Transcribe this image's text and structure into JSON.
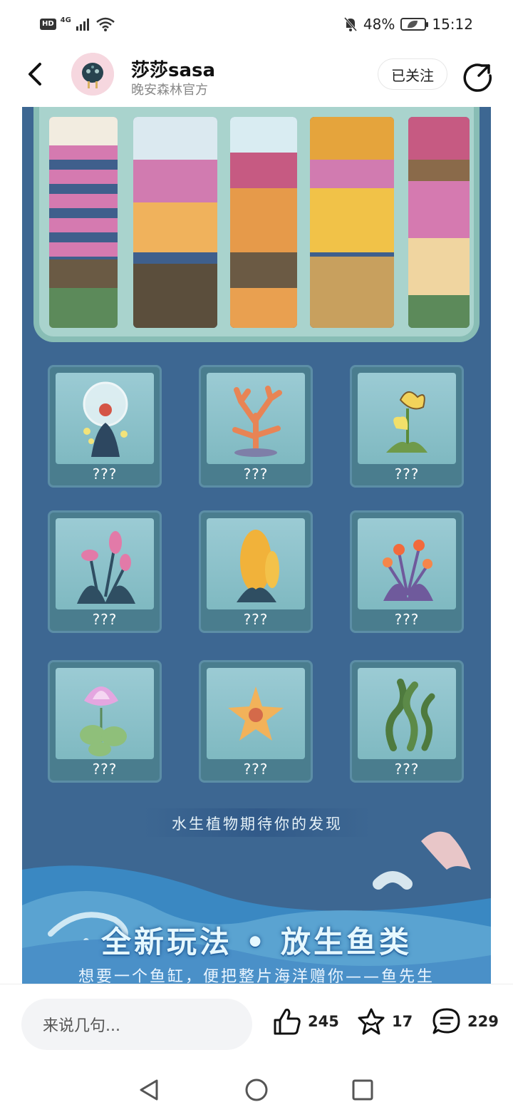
{
  "status_bar": {
    "hd": "HD",
    "network": "4G",
    "battery": "48%",
    "time": "15:12"
  },
  "header": {
    "author_name": "莎莎sasa",
    "author_subtitle": "晚安森林官方",
    "follow_label": "已关注"
  },
  "content": {
    "plants": [
      {
        "label": "???",
        "icon": "jellyfish-plant-icon"
      },
      {
        "label": "???",
        "icon": "coral-icon"
      },
      {
        "label": "???",
        "icon": "yellow-iris-icon"
      },
      {
        "label": "???",
        "icon": "pink-lily-icon"
      },
      {
        "label": "???",
        "icon": "orange-flower-spike-icon"
      },
      {
        "label": "???",
        "icon": "glowing-lantern-plant-icon"
      },
      {
        "label": "???",
        "icon": "water-lily-icon"
      },
      {
        "label": "???",
        "icon": "starfish-plant-icon"
      },
      {
        "label": "???",
        "icon": "seaweed-icon"
      }
    ],
    "tagline": "水生植物期待你的发现",
    "banner_title": "全新玩法 • 放生鱼类",
    "banner_subtitle": "想要一个鱼缸，便把整片海洋赠你——鱼先生"
  },
  "bottom_bar": {
    "comment_placeholder": "来说几句...",
    "likes": "245",
    "favorites": "17",
    "comments": "229"
  },
  "colors": {
    "ocean_blue": "#3d6792",
    "card_teal": "#4a7d8e",
    "garden_aqua": "#a9d3cd"
  }
}
